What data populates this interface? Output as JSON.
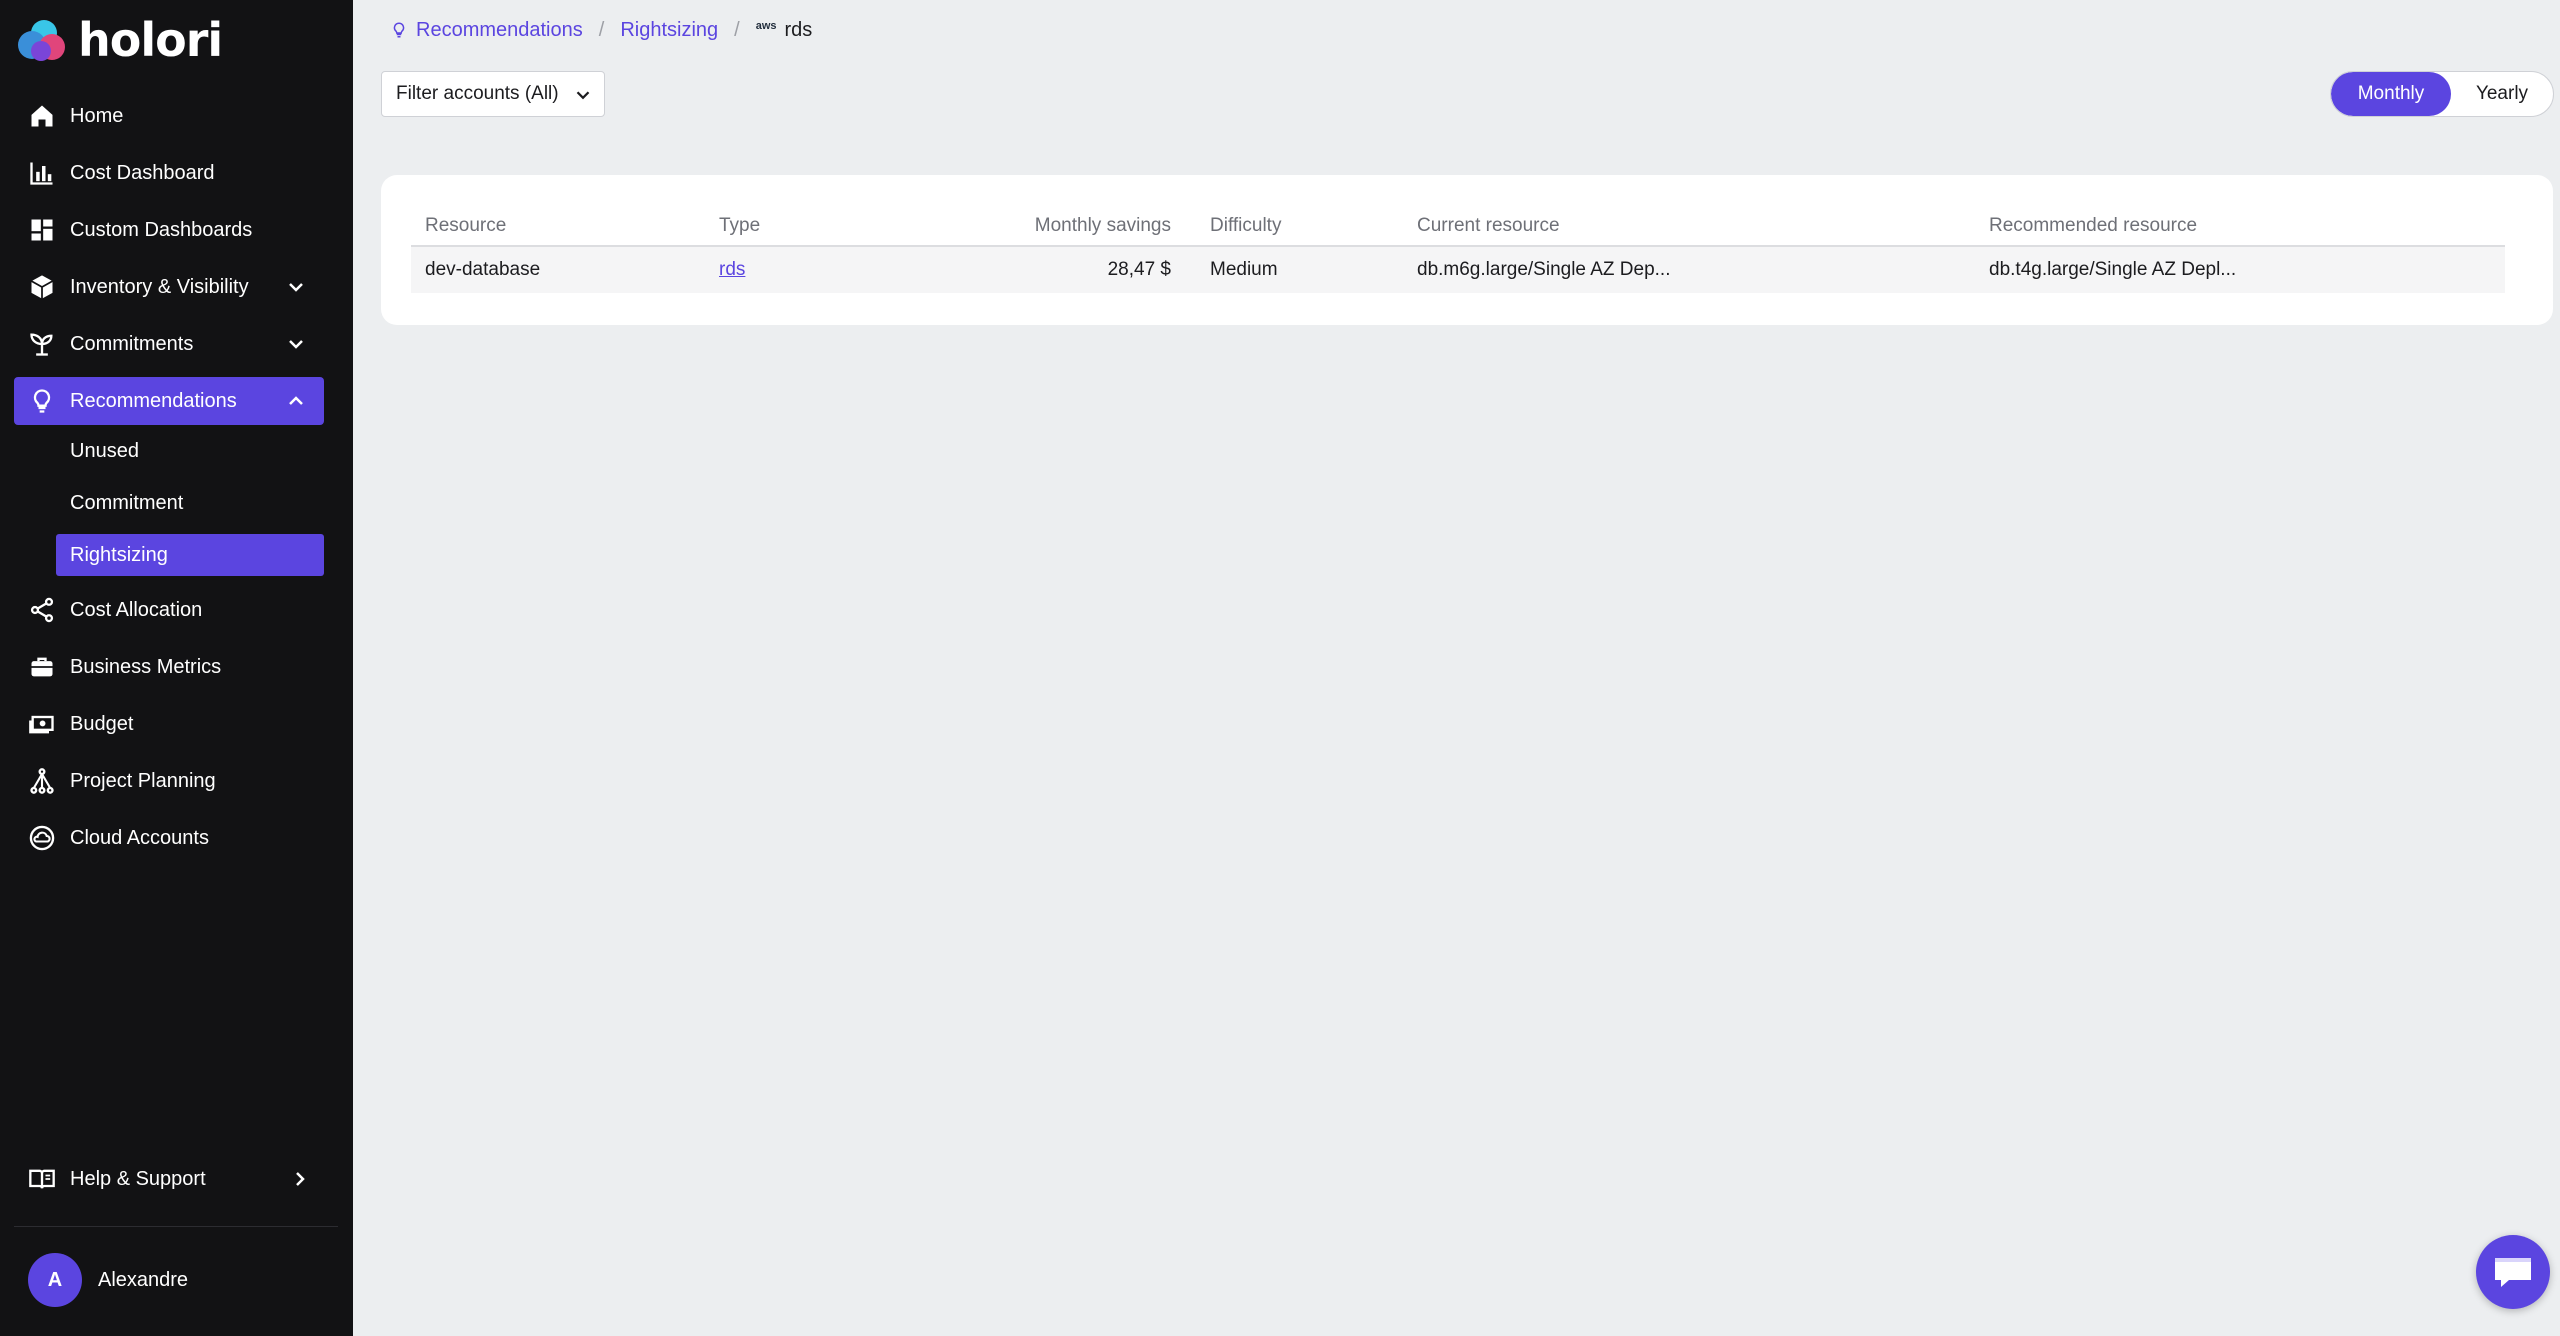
{
  "app": {
    "logo_text": "holori"
  },
  "sidebar": {
    "items": [
      {
        "label": "Home",
        "icon": "home-icon"
      },
      {
        "label": "Cost Dashboard",
        "icon": "bar-chart-icon"
      },
      {
        "label": "Custom Dashboards",
        "icon": "dashboard-icon"
      },
      {
        "label": "Inventory & Visibility",
        "icon": "cube-icon",
        "expandable": true
      },
      {
        "label": "Commitments",
        "icon": "plant-icon",
        "expandable": true
      },
      {
        "label": "Recommendations",
        "icon": "lightbulb-icon",
        "expanded": true,
        "active": true
      },
      {
        "label": "Cost Allocation",
        "icon": "share-icon"
      },
      {
        "label": "Business Metrics",
        "icon": "briefcase-icon"
      },
      {
        "label": "Budget",
        "icon": "money-icon"
      },
      {
        "label": "Project Planning",
        "icon": "network-icon"
      },
      {
        "label": "Cloud Accounts",
        "icon": "cloud-circle-icon"
      }
    ],
    "sub_items": [
      {
        "label": "Unused"
      },
      {
        "label": "Commitment"
      },
      {
        "label": "Rightsizing",
        "active": true
      }
    ],
    "help_label": "Help & Support",
    "user": {
      "initial": "A",
      "name": "Alexandre"
    }
  },
  "breadcrumb": {
    "items": [
      "Recommendations",
      "Rightsizing"
    ],
    "current": "rds",
    "current_badge": "aws",
    "separator": "/"
  },
  "filter": {
    "label": "Filter accounts (All)"
  },
  "period_toggle": {
    "options": [
      "Monthly",
      "Yearly"
    ],
    "selected": "Monthly"
  },
  "table": {
    "columns": [
      "Resource",
      "Type",
      "Monthly savings",
      "Difficulty",
      "Current resource",
      "Recommended resource"
    ],
    "rows": [
      {
        "resource": "dev-database",
        "type": "rds",
        "monthly_savings": "28,47 $",
        "difficulty": "Medium",
        "current_resource": "db.m6g.large/Single AZ Dep...",
        "recommended_resource": "db.t4g.large/Single AZ Depl..."
      }
    ]
  },
  "colors": {
    "accent": "#5b45e0",
    "sidebar_bg": "#121214",
    "page_bg": "#eceef0"
  }
}
